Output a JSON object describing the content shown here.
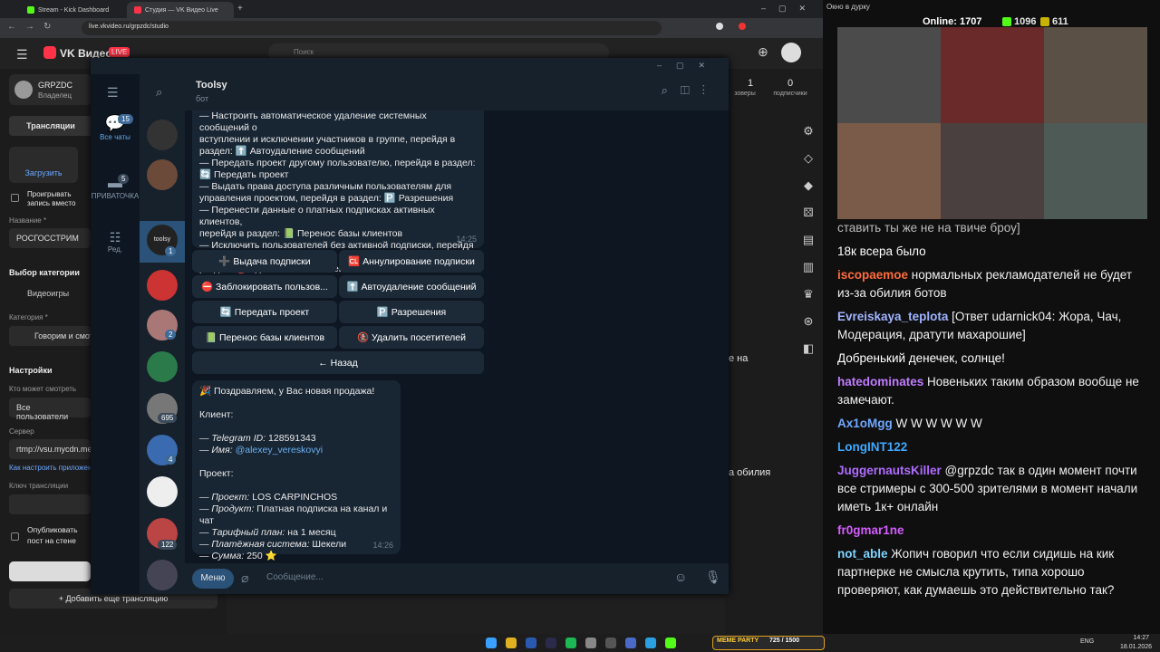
{
  "browser": {
    "tabs": [
      {
        "label": "Stream - Kick Dashboard",
        "color": "#53fc18"
      },
      {
        "label": "Студия — VK Видео Live",
        "color": "#ff3347"
      }
    ],
    "url": "live.vkvideo.ru/grpzdc/studio",
    "search_placeholder": "Поиск"
  },
  "vk": {
    "logo": "VK Видео",
    "live_badge": "LIVE",
    "channel": "GRPZDC",
    "role": "Владелец",
    "stat1": {
      "value": "1",
      "label": "зоверы"
    },
    "stat2": {
      "value": "0",
      "label": "подписчики"
    },
    "nav_broadcasts": "Трансляции",
    "upload": "Загрузить",
    "play_preview": "Проигрывать запись вместо обложки",
    "name_label": "Название *",
    "name_value": "РОСГОССТРИМ",
    "category_section": "Выбор категории",
    "games": "Видеоигры",
    "category_label": "Категория *",
    "category_value": "Говорим и смотрим",
    "settings": "Настройки",
    "who_can_watch": "Кто может смотреть",
    "who_value": "Все пользователи",
    "server_label": "Сервер",
    "server_value": "rtmp://vsu.mycdn.me/",
    "howto": "Как настроить приложение",
    "key_label": "Ключ трансляции",
    "publish": "Опубликовать пост на стене сообщества",
    "add_broadcast": "+ Добавить еще трансляцию",
    "side_text1": "е на",
    "side_text2": "а обилия"
  },
  "telegram": {
    "folders": [
      {
        "label": "Все чаты",
        "badge": "15"
      },
      {
        "label": "ПРИВАТОЧКА",
        "badge": "5"
      },
      {
        "label": "Ред.",
        "badge": ""
      }
    ],
    "list_badges": [
      "1",
      "2",
      "695",
      "4",
      "122"
    ],
    "chat_title": "Toolsy",
    "chat_subtitle": "бот",
    "msg1_lines": [
      "— Настроить автоматическое удаление системных сообщений о",
      "вступлении и исключении участников в группе, перейдя в",
      "раздел: ⬆️ Автоудаление сообщений",
      "— Передать проект другому пользователю, перейдя в раздел:",
      "🔄 Передать проект",
      "— Выдать права доступа различным пользователям для",
      "управления проектом, перейдя в раздел: 🅿️ Разрешения",
      "— Перенести данные о платных подписках активных клиентов,",
      "перейдя в раздел: 📗 Перенос базы клиентов",
      "— Исключить пользователей без активной подписки, перейдя в",
      "раздел: 🚷 Удалить посетителей"
    ],
    "msg1_time": "14:25",
    "buttons": [
      "➕ Выдача подписки",
      "🆑 Аннулирование подписки",
      "⛔ Заблокировать пользов...",
      "⬆️ Автоудаление сообщений",
      "🔄 Передать проект",
      "🅿️ Разрешения",
      "📗 Перенос базы клиентов",
      "🚷 Удалить посетителей"
    ],
    "back": "← Назад",
    "msg2": {
      "title": "🎉 Поздравляем, у Вас новая продажа!",
      "client": "Клиент:",
      "tgid_k": "— Telegram ID:",
      "tgid_v": " 128591343",
      "name_k": "— Имя:",
      "name_v": " @alexey_vereskovyi",
      "project": "Проект:",
      "proj_k": "— Проект:",
      "proj_v": " LOS CARPINCHOS",
      "prod_k": "— Продукт:",
      "prod_v": " Платная подписка на канал и чат",
      "plan_k": "— Тарифный план:",
      "plan_v": " на 1 месяц",
      "pay_k": "— Платёжная система:",
      "pay_v": " Шекели",
      "sum_k": "— Сумма:",
      "sum_v": " 250 ⭐",
      "time": "14:26"
    },
    "menu_button": "Меню",
    "input_placeholder": "Сообщение..."
  },
  "stream": {
    "window_title": "Окно в дурку",
    "online_label": "Online:",
    "online_value": "1707",
    "kick_count": "1096",
    "other_count": "611",
    "chat": [
      {
        "nick": "",
        "color": "#bbbbbb",
        "text": "ставить ты же не на твиче броу]"
      },
      {
        "nick": "",
        "color": "#ffffff",
        "text": "18к всера было"
      },
      {
        "nick": "iscopaemoe",
        "color": "#ff6b3d",
        "text": " нормальных рекламодателей не будет из-за обилия ботов"
      },
      {
        "nick": "Evreiskaya_teplota",
        "color": "#9fb4ff",
        "text": " [Ответ udarnick04: Жора, Чач, Модерация, дратути махарошие]"
      },
      {
        "nick": "",
        "color": "#ffffff",
        "text": "Добренький денечек, солнце!"
      },
      {
        "nick": "hatedominates",
        "color": "#c07cff",
        "text": " Новеньких таким образом вообще не замечают."
      },
      {
        "nick": "Ax1oMgg",
        "color": "#6fa8ff",
        "text": " W W W W W W"
      },
      {
        "nick": "LongINT122",
        "color": "#3fa9ff",
        "text": ""
      },
      {
        "nick": "JuggernautsKiller",
        "color": "#b06cff",
        "text": " @grpzdc так в один момент почти все стримеры с 300-500 зрителями в момент начали иметь 1к+ онлайн"
      },
      {
        "nick": "fr0gmar1ne",
        "color": "#d45cff",
        "text": ""
      },
      {
        "nick": "not_able",
        "color": "#7fd3ff",
        "text": " Жопич говорил что если сидишь на кик партнерке не смысла крутить, типа хорошо проверяют, как думаешь это действительно так?"
      }
    ]
  },
  "taskbar": {
    "time": "14:27",
    "date": "18.01.2026",
    "lang": "ENG",
    "meme": "MEME PARTY",
    "meme_progress": "725 / 1500"
  }
}
